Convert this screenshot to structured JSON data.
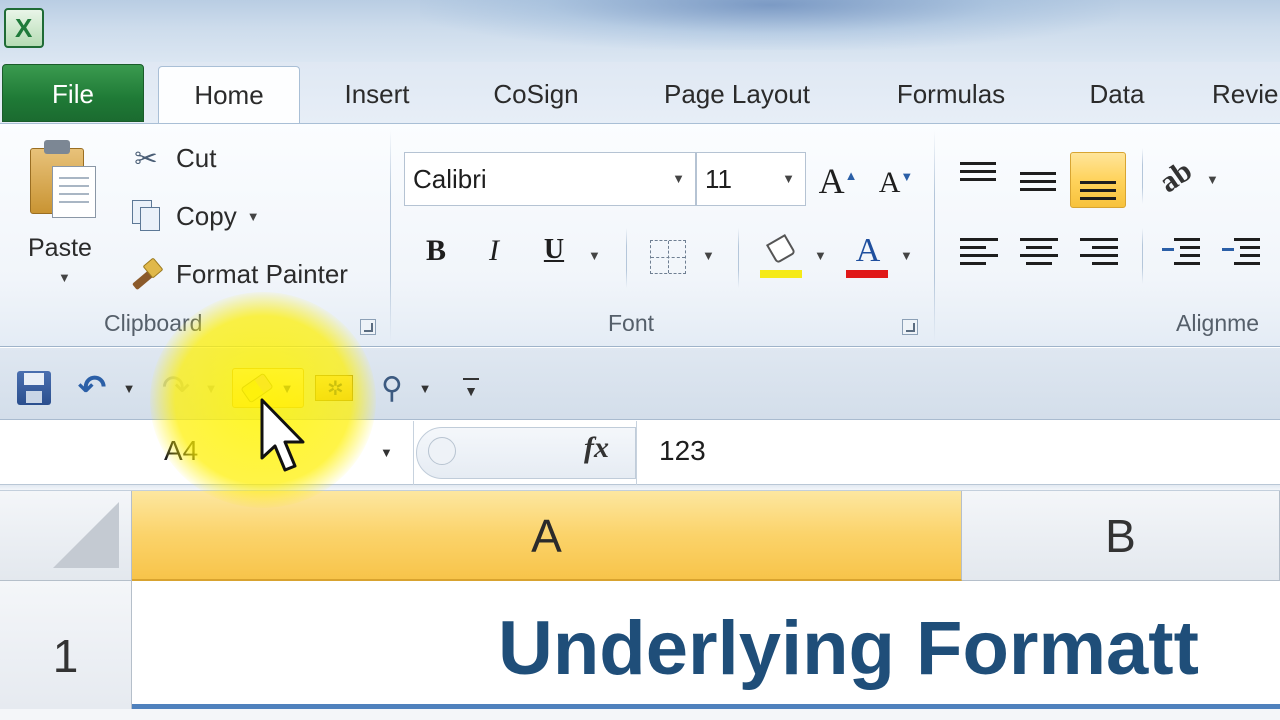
{
  "app": {
    "icon": "excel-app-icon",
    "icon_letter": "X"
  },
  "tabs": [
    {
      "id": "file",
      "label": "File"
    },
    {
      "id": "home",
      "label": "Home",
      "active": true
    },
    {
      "id": "insert",
      "label": "Insert"
    },
    {
      "id": "cosign",
      "label": "CoSign"
    },
    {
      "id": "pagelayout",
      "label": "Page Layout"
    },
    {
      "id": "formulas",
      "label": "Formulas"
    },
    {
      "id": "data",
      "label": "Data"
    },
    {
      "id": "review",
      "label": "Revie"
    }
  ],
  "ribbon": {
    "clipboard": {
      "label": "Clipboard",
      "paste": "Paste",
      "cut": "Cut",
      "copy": "Copy",
      "format_painter": "Format Painter"
    },
    "font": {
      "label": "Font",
      "font_name": "Calibri",
      "font_size": "11",
      "bold": "B",
      "italic": "I",
      "underline": "U",
      "grow": "A",
      "shrink": "A",
      "font_color_glyph": "A",
      "fill_color": "#f5ea17",
      "font_color": "#e01818"
    },
    "alignment": {
      "label": "Alignme"
    }
  },
  "qat": {
    "items": [
      "save-icon",
      "undo-icon",
      "redo-icon",
      "clear-formats-icon",
      "camera-icon",
      "find-icon",
      "customize-qat-icon"
    ]
  },
  "formula_bar": {
    "name_box": "A4",
    "fx": "fx",
    "value": "123"
  },
  "grid": {
    "columns": [
      "A",
      "B"
    ],
    "rows": [
      "1"
    ],
    "cell_a1": "Underlying Formatt",
    "selected_column": "A",
    "title_color": "#1f4e79"
  },
  "colors": {
    "file_tab": "#1f7a36",
    "highlight": "#fff000",
    "selection": "#fbd36a"
  }
}
